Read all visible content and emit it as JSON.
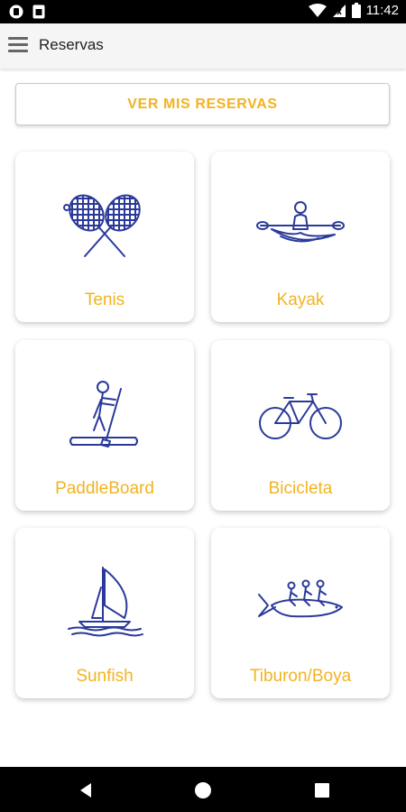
{
  "status_bar": {
    "time": "11:42",
    "left_icons": [
      "notification-icon",
      "sim-icon"
    ],
    "right_icons": [
      "wifi-icon",
      "signal-icon",
      "battery-icon"
    ]
  },
  "app_bar": {
    "title": "Reservas",
    "menu_icon": "menu-icon"
  },
  "reservas_button": {
    "label": "VER MIS RESERVAS"
  },
  "activities": [
    {
      "label": "Tenis",
      "icon": "tennis-rackets-icon"
    },
    {
      "label": "Kayak",
      "icon": "kayak-icon"
    },
    {
      "label": "PaddleBoard",
      "icon": "paddleboard-icon"
    },
    {
      "label": "Bicicleta",
      "icon": "bicycle-icon"
    },
    {
      "label": "Sunfish",
      "icon": "sailboat-icon"
    },
    {
      "label": "Tiburon/Boya",
      "icon": "banana-boat-icon"
    }
  ],
  "nav_bar": {
    "icons": [
      "back-icon",
      "home-icon",
      "recents-icon"
    ]
  },
  "colors": {
    "accent": "#f2b321",
    "icon": "#2b3a9a",
    "status_bar": "#000000",
    "app_bar": "#f5f5f5"
  }
}
